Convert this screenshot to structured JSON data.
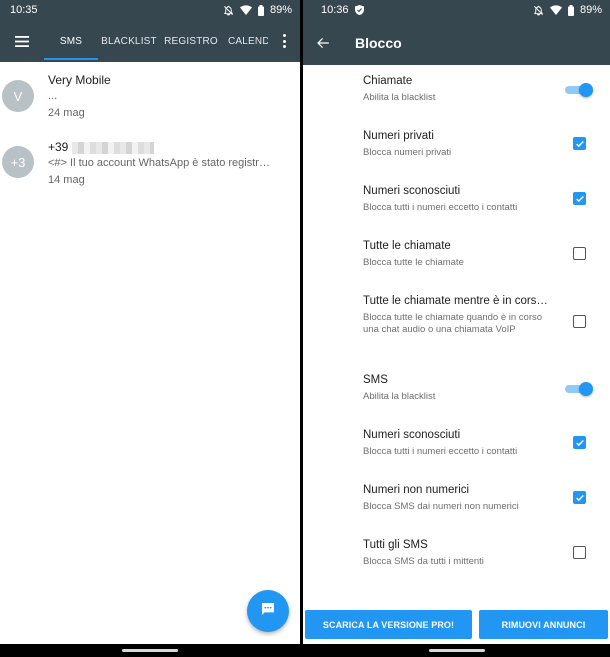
{
  "left": {
    "status": {
      "time": "10:35",
      "battery": "89%"
    },
    "tabs": [
      {
        "label": "SMS",
        "active": true
      },
      {
        "label": "BLACKLIST",
        "active": false
      },
      {
        "label": "REGISTRO",
        "active": false
      },
      {
        "label": "CALENDA",
        "active": false
      }
    ],
    "conversations": [
      {
        "avatar": "V",
        "name": "Very Mobile",
        "snippet": "...",
        "date": "24 mag"
      },
      {
        "avatar": "+3",
        "name": "+39",
        "snippet": "<#> Il tuo account WhatsApp è stato registr…",
        "date": "14 mag"
      }
    ],
    "icons": {
      "menu": "hamburger-menu-icon",
      "overflow": "more-vert-icon",
      "fab": "new-message-icon"
    }
  },
  "right": {
    "status": {
      "time": "10:36",
      "battery": "89%"
    },
    "title": "Blocco",
    "settings": [
      {
        "title": "Chiamate",
        "subtitle": "Abilita la blacklist",
        "control": "toggle",
        "checked": true
      },
      {
        "title": "Numeri privati",
        "subtitle": "Blocca numeri privati",
        "control": "checkbox",
        "checked": true
      },
      {
        "title": "Numeri sconosciuti",
        "subtitle": "Blocca tutti i numeri eccetto i contatti",
        "control": "checkbox",
        "checked": true
      },
      {
        "title": "Tutte le chiamate",
        "subtitle": "Blocca tutte le chiamate",
        "control": "checkbox",
        "checked": false
      },
      {
        "title": "Tutte le chiamate mentre è in cors…",
        "subtitle": "Blocca tutte le chiamate quando è in corso una chat audio o una chiamata VoIP",
        "control": "checkbox",
        "checked": false
      },
      {
        "title": "SMS",
        "subtitle": "Abilita la blacklist",
        "control": "toggle",
        "checked": true
      },
      {
        "title": "Numeri sconosciuti",
        "subtitle": "Blocca tutti i numeri eccetto i contatti",
        "control": "checkbox",
        "checked": true
      },
      {
        "title": "Numeri non numerici",
        "subtitle": "Blocca SMS dai numeri non numerici",
        "control": "checkbox",
        "checked": true
      },
      {
        "title": "Tutti gli SMS",
        "subtitle": "Blocca SMS da tutti i mittenti",
        "control": "checkbox",
        "checked": false
      }
    ],
    "buttons": {
      "pro": "SCARICA LA VERSIONE PRO!",
      "ads": "RIMUOVI ANNUNCI"
    }
  },
  "colors": {
    "appbar": "#37474f",
    "accent": "#2196f3",
    "toggle_track": "#90caf9"
  }
}
